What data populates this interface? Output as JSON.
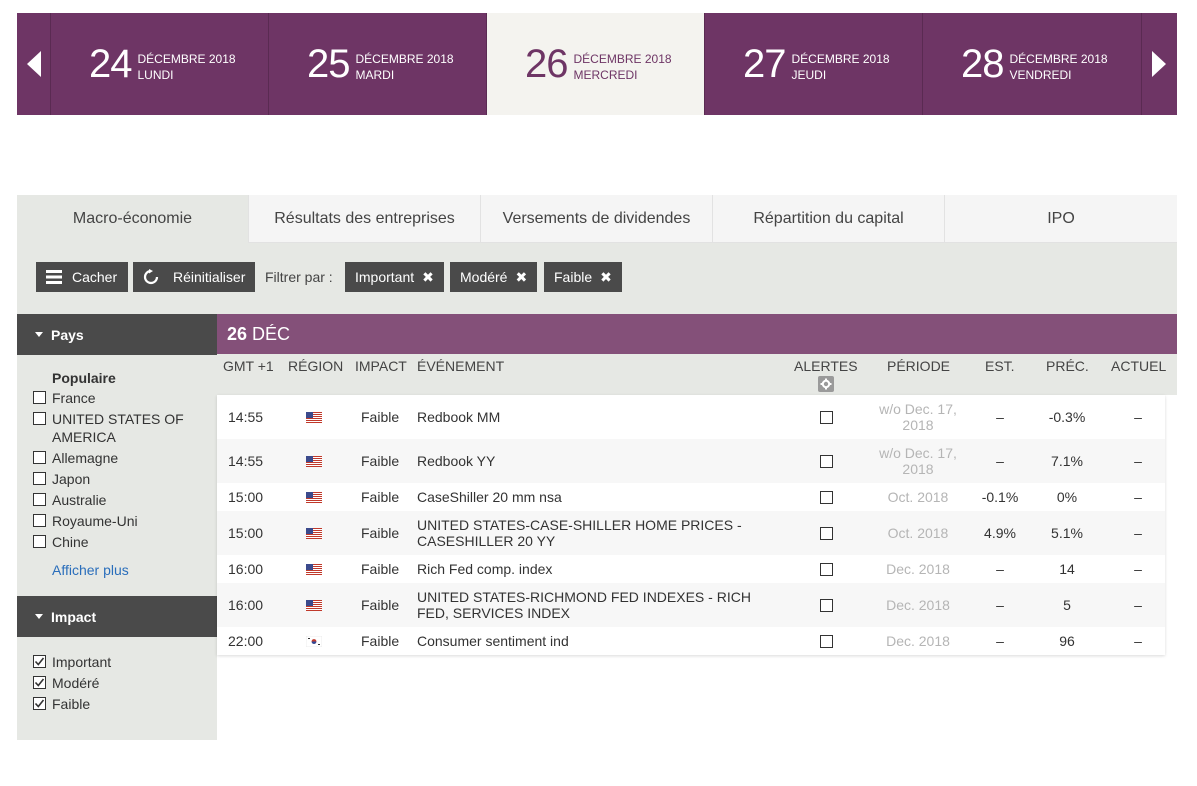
{
  "dates": [
    {
      "day": "24",
      "month": "DÉCEMBRE 2018",
      "weekday": "LUNDI"
    },
    {
      "day": "25",
      "month": "DÉCEMBRE 2018",
      "weekday": "MARDI"
    },
    {
      "day": "26",
      "month": "DÉCEMBRE 2018",
      "weekday": "MERCREDI"
    },
    {
      "day": "27",
      "month": "DÉCEMBRE 2018",
      "weekday": "JEUDI"
    },
    {
      "day": "28",
      "month": "DÉCEMBRE 2018",
      "weekday": "VENDREDI"
    }
  ],
  "active_date_index": 2,
  "tabs": [
    {
      "label": "Macro-économie",
      "active": true
    },
    {
      "label": "Résultats des entreprises",
      "active": false
    },
    {
      "label": "Versements de dividendes",
      "active": false
    },
    {
      "label": "Répartition du capital",
      "active": false
    },
    {
      "label": "IPO",
      "active": false
    }
  ],
  "toolbar": {
    "hide_label": "Cacher",
    "reset_label": "Réinitialiser",
    "filter_by_label": "Filtrer par :",
    "chips": [
      "Important",
      "Modéré",
      "Faible"
    ],
    "chip_remove_glyph": "✖"
  },
  "sidebar": {
    "country_header": "Pays",
    "popular_title": "Populaire",
    "countries": [
      {
        "label": "France",
        "checked": false
      },
      {
        "label": "UNITED STATES OF AMERICA",
        "checked": false
      },
      {
        "label": "Allemagne",
        "checked": false
      },
      {
        "label": "Japon",
        "checked": false
      },
      {
        "label": "Australie",
        "checked": false
      },
      {
        "label": "Royaume-Uni",
        "checked": false
      },
      {
        "label": "Chine",
        "checked": false
      }
    ],
    "show_more": "Afficher plus",
    "impact_header": "Impact",
    "impacts": [
      {
        "label": "Important",
        "checked": true
      },
      {
        "label": "Modéré",
        "checked": true
      },
      {
        "label": "Faible",
        "checked": true
      }
    ]
  },
  "table": {
    "day_num": "26",
    "day_month": "DÉC",
    "headers": {
      "time": "GMT +1",
      "region": "RÉGION",
      "impact": "IMPACT",
      "event": "ÉVÉNEMENT",
      "alerts": "ALERTES",
      "period": "PÉRIODE",
      "est": "EST.",
      "prev": "PRÉC.",
      "actual": "ACTUEL"
    },
    "rows": [
      {
        "time": "14:55",
        "flag": "us",
        "impact": "Faible",
        "event": "Redbook MM",
        "period": "w/o Dec. 17, 2018",
        "est": "–",
        "prev": "-0.3%",
        "actual": "–",
        "tall": true
      },
      {
        "time": "14:55",
        "flag": "us",
        "impact": "Faible",
        "event": "Redbook YY",
        "period": "w/o Dec. 17, 2018",
        "est": "–",
        "prev": "7.1%",
        "actual": "–",
        "tall": true
      },
      {
        "time": "15:00",
        "flag": "us",
        "impact": "Faible",
        "event": "CaseShiller 20 mm nsa",
        "period": "Oct. 2018",
        "est": "-0.1%",
        "prev": "0%",
        "actual": "–",
        "tall": false
      },
      {
        "time": "15:00",
        "flag": "us",
        "impact": "Faible",
        "event": "UNITED STATES-CASE-SHILLER HOME PRICES - CASESHILLER 20 YY",
        "period": "Oct. 2018",
        "est": "4.9%",
        "prev": "5.1%",
        "actual": "–",
        "tall": true
      },
      {
        "time": "16:00",
        "flag": "us",
        "impact": "Faible",
        "event": "Rich Fed comp. index",
        "period": "Dec. 2018",
        "est": "–",
        "prev": "14",
        "actual": "–",
        "tall": false
      },
      {
        "time": "16:00",
        "flag": "us",
        "impact": "Faible",
        "event": "UNITED STATES-RICHMOND FED INDEXES - RICH FED, SERVICES INDEX",
        "period": "Dec. 2018",
        "est": "–",
        "prev": "5",
        "actual": "–",
        "tall": true
      },
      {
        "time": "22:00",
        "flag": "kr",
        "impact": "Faible",
        "event": "Consumer sentiment ind",
        "period": "Dec. 2018",
        "est": "–",
        "prev": "96",
        "actual": "–",
        "tall": false
      }
    ]
  },
  "colors": {
    "brand_purple": "#6e3565",
    "day_header_purple": "#845079",
    "dark_button": "#4a4a4a",
    "panel_grey": "#e6e8e4",
    "link_blue": "#2a6ebb"
  }
}
